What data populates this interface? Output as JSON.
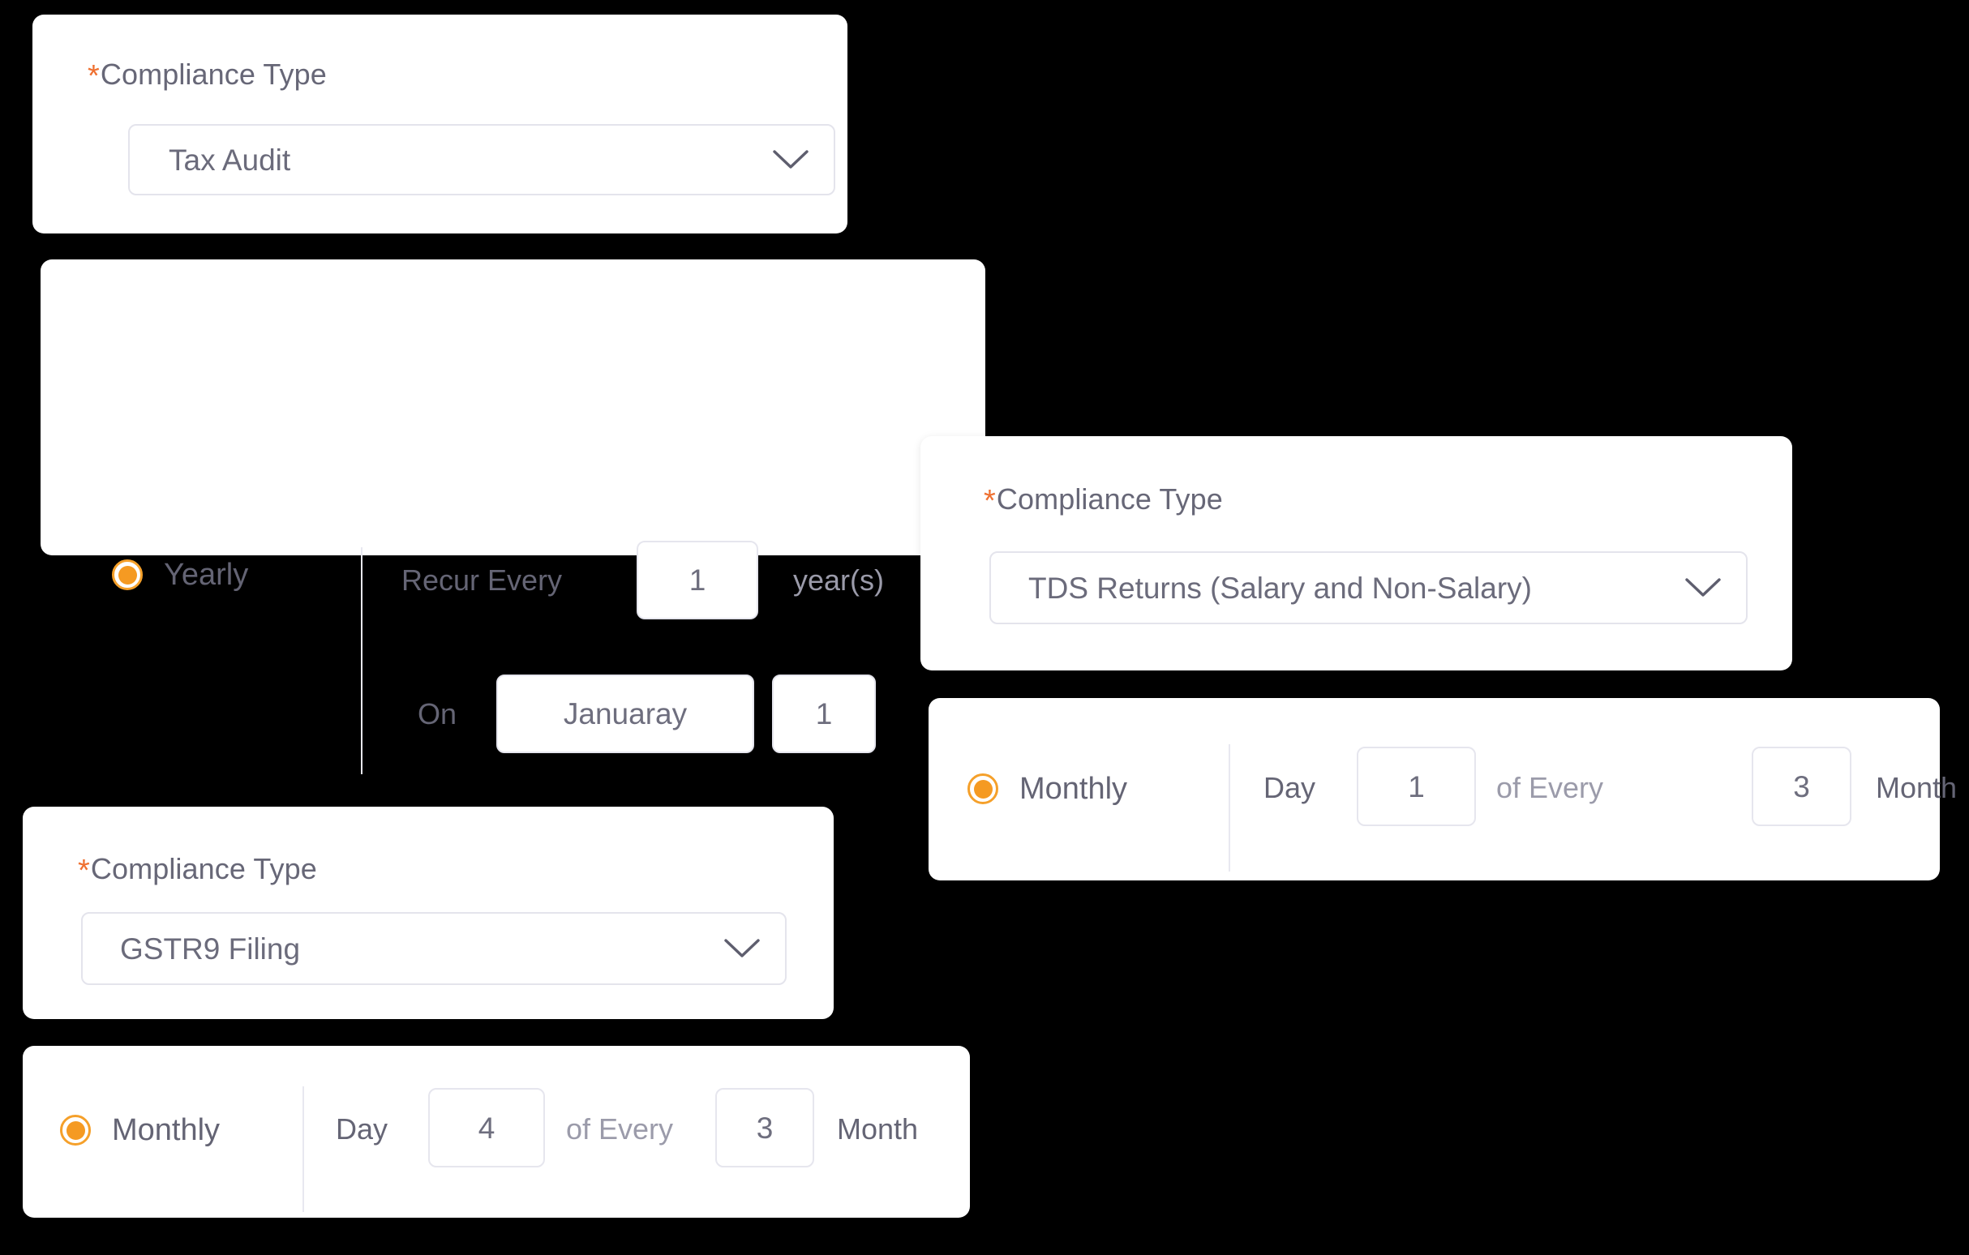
{
  "colors": {
    "page_background": "#000000",
    "card_background": "#ffffff",
    "accent_orange": "#f59a22",
    "required_star": "#ef7030",
    "label_text": "#676777",
    "muted_text": "#9b9baa",
    "border": "#e4e4ec"
  },
  "cards": {
    "compliance_tax_audit": {
      "label_text": "Compliance Type",
      "required_marker": "*",
      "select": {
        "value": "Tax Audit",
        "icon": "chevron-down-icon"
      }
    },
    "recurrence_yearly": {
      "radio": {
        "label": "Yearly",
        "selected": true
      },
      "row_recur": {
        "prefix_label": "Recur Every",
        "interval_value": "1",
        "suffix_label": "year(s)"
      },
      "row_on": {
        "prefix_label": "On",
        "month_value": "Januaray",
        "day_value": "1"
      }
    },
    "compliance_tds": {
      "label_text": "Compliance Type",
      "required_marker": "*",
      "select": {
        "value": "TDS Returns (Salary and Non-Salary)",
        "icon": "chevron-down-icon"
      }
    },
    "recurrence_monthly_tds": {
      "radio": {
        "label": "Monthly",
        "selected": true
      },
      "row": {
        "day_label": "Day",
        "day_value": "1",
        "of_every_label": "of Every",
        "month_interval_value": "3",
        "month_label": "Month"
      }
    },
    "compliance_gstr9": {
      "label_text": "Compliance Type",
      "required_marker": "*",
      "select": {
        "value": "GSTR9 Filing",
        "icon": "chevron-down-icon"
      }
    },
    "recurrence_monthly_gstr9": {
      "radio": {
        "label": "Monthly",
        "selected": true
      },
      "row": {
        "day_label": "Day",
        "day_value": "4",
        "of_every_label": "of Every",
        "month_interval_value": "3",
        "month_label": "Month"
      }
    }
  }
}
